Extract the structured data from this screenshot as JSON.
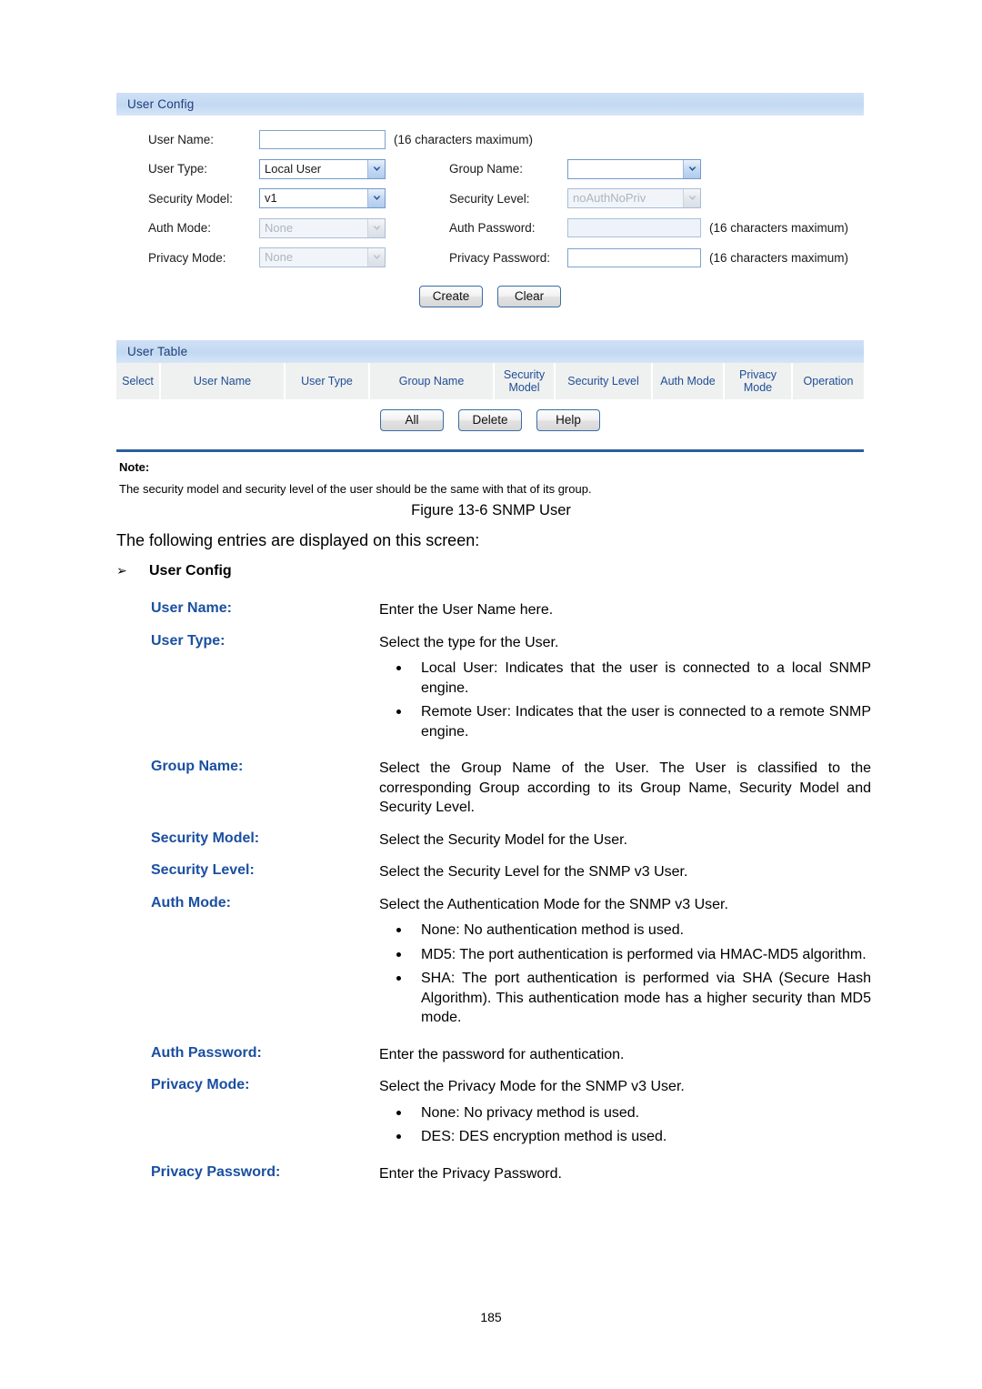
{
  "figure": {
    "user_config": {
      "panel_title": "User Config",
      "fields": {
        "user_name_label": "User Name:",
        "user_name_value": "",
        "user_name_hint": "(16 characters maximum)",
        "user_type_label": "User Type:",
        "user_type_value": "Local User",
        "group_name_label": "Group Name:",
        "group_name_value": "",
        "security_model_label": "Security Model:",
        "security_model_value": "v1",
        "security_level_label": "Security Level:",
        "security_level_value": "noAuthNoPriv",
        "auth_mode_label": "Auth Mode:",
        "auth_mode_value": "None",
        "auth_password_label": "Auth Password:",
        "auth_password_value": "",
        "auth_password_hint": "(16 characters maximum)",
        "privacy_mode_label": "Privacy Mode:",
        "privacy_mode_value": "None",
        "privacy_password_label": "Privacy Password:",
        "privacy_password_value": "",
        "privacy_password_hint": "(16 characters maximum)"
      },
      "buttons": {
        "create": "Create",
        "clear": "Clear"
      }
    },
    "user_table": {
      "panel_title": "User Table",
      "columns": [
        "Select",
        "User Name",
        "User Type",
        "Group Name",
        "Security Model",
        "Security Level",
        "Auth Mode",
        "Privacy Mode",
        "Operation"
      ],
      "rows": [],
      "buttons": {
        "all": "All",
        "delete": "Delete",
        "help": "Help"
      }
    },
    "note": {
      "title": "Note:",
      "text": "The security model and security level of the user should be the same with that of its group."
    },
    "colors": {
      "panel_header_bg": "#c3d9f2",
      "panel_header_text": "#1f3f7a",
      "table_header_text": "#1f4e96",
      "divider": "#2b5f9e",
      "button_border": "#3a6ea5"
    }
  },
  "document": {
    "figure_caption": "Figure 13-6 SNMP User",
    "lead": "The following entries are displayed on this screen:",
    "section_marker": "➢",
    "section_title": "User Config",
    "entries": [
      {
        "term": "User Name:",
        "desc": "Enter the User Name here.",
        "sub": []
      },
      {
        "term": "User Type:",
        "desc": "Select the type for the User.",
        "sub": [
          "Local User: Indicates that the user is connected to a local SNMP engine.",
          "Remote User: Indicates that the user is connected to a remote SNMP engine."
        ]
      },
      {
        "term": "Group Name:",
        "desc": "Select the Group Name of the User. The User is classified to the corresponding Group according to its Group Name, Security Model and Security Level.",
        "sub": []
      },
      {
        "term": "Security Model:",
        "desc": "Select the Security Model for the User.",
        "sub": []
      },
      {
        "term": "Security Level:",
        "desc": "Select the Security Level for the SNMP v3 User.",
        "sub": []
      },
      {
        "term": "Auth Mode:",
        "desc": "Select the Authentication Mode for the SNMP v3 User.",
        "sub": [
          "None: No authentication method is used.",
          "MD5: The port authentication is performed via HMAC-MD5 algorithm.",
          "SHA: The port authentication is performed via SHA (Secure Hash Algorithm). This authentication mode has a higher security than MD5 mode."
        ]
      },
      {
        "term": "Auth Password:",
        "desc": "Enter the password for authentication.",
        "sub": []
      },
      {
        "term": "Privacy Mode:",
        "desc": "Select the Privacy Mode for the SNMP v3 User.",
        "sub": [
          "None: No privacy method is used.",
          "DES: DES encryption method is used."
        ]
      },
      {
        "term": "Privacy Password:",
        "desc": "Enter the Privacy Password.",
        "sub": []
      }
    ],
    "page_number": "185"
  }
}
